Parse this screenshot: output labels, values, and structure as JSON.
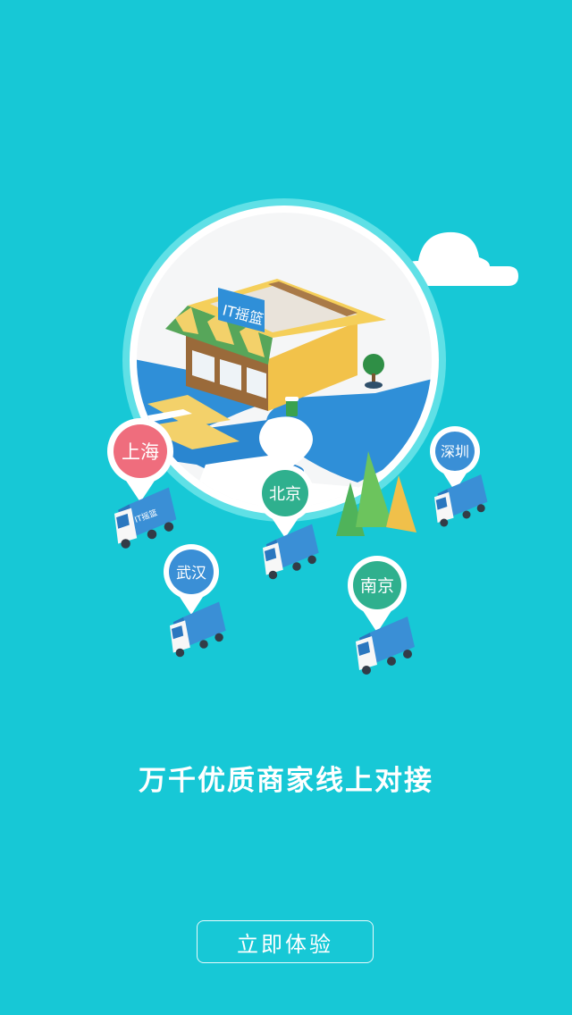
{
  "store_sign": "IT摇篮",
  "truck_sign": "IT摇篮",
  "cities": {
    "shanghai": "上海",
    "wuhan": "武汉",
    "beijing": "北京",
    "nanjing": "南京",
    "shenzhen": "深圳"
  },
  "tagline": "万千优质商家线上对接",
  "cta_label": "立即体验",
  "colors": {
    "background": "#17c8d6",
    "pin_red": "#ef6d7d",
    "pin_blue": "#3a8fd6",
    "pin_green": "#2fb08e"
  }
}
